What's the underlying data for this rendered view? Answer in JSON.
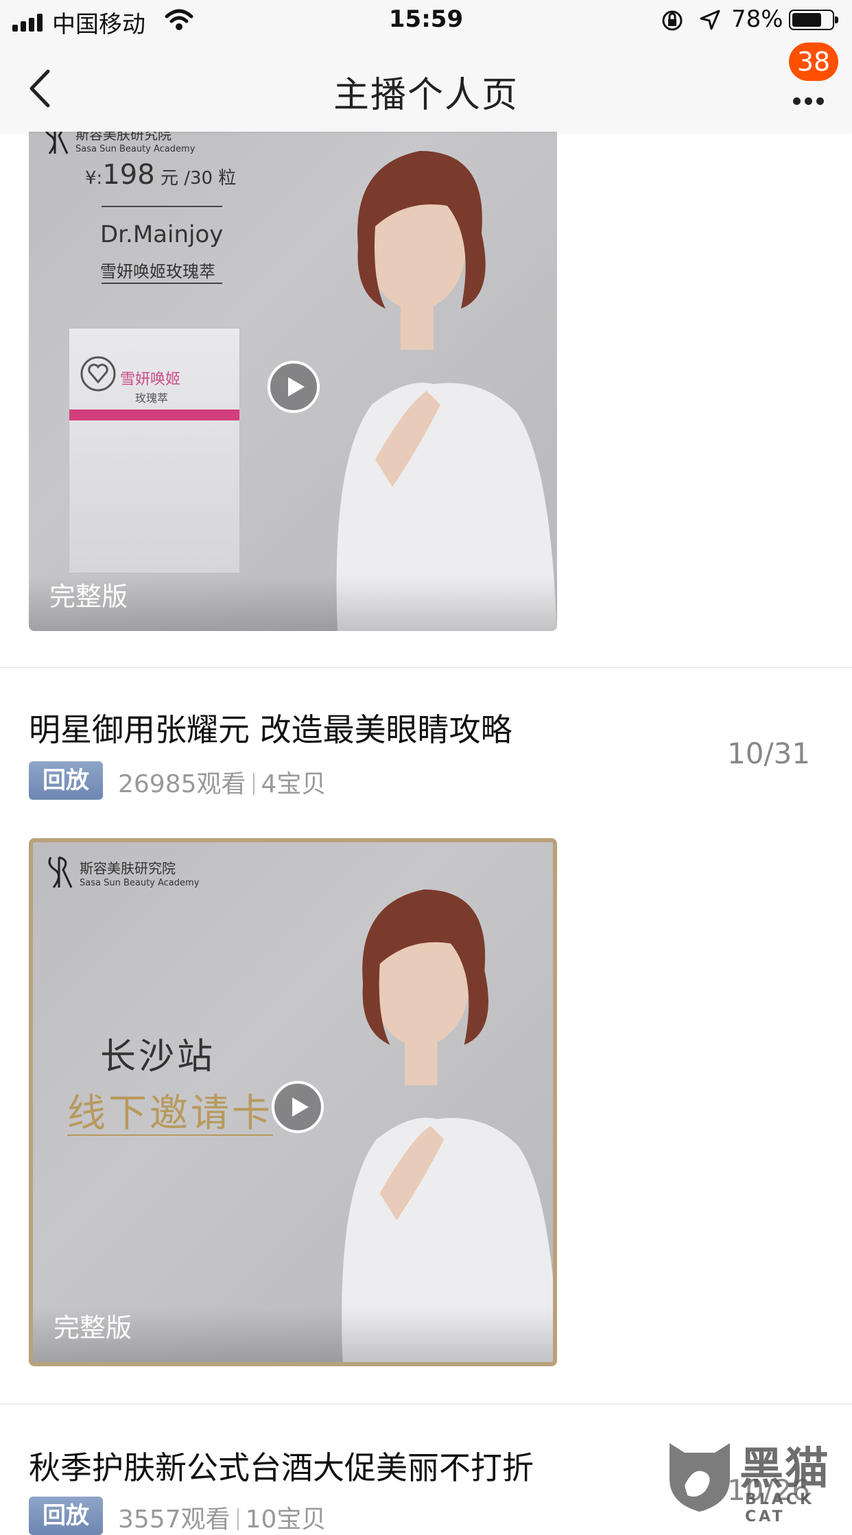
{
  "status_bar": {
    "carrier": "中国移动",
    "time": "15:59",
    "battery_percent": "78%",
    "battery_level": 0.78
  },
  "nav": {
    "title": "主播个人页",
    "badge_count": "38"
  },
  "videos": [
    {
      "org_cn": "斯容美肤研究院",
      "org_en": "Sasa Sun Beauty Academy",
      "price_prefix": "¥:",
      "price_value": "198",
      "price_suffix": "元 /30 粒",
      "product_en": "Dr.Mainjoy",
      "product_cn": "雪妍唤姬玫瑰萃",
      "box_name": "雪妍唤姬",
      "box_sub": "玫瑰萃",
      "full_version_label": "完整版"
    },
    {
      "title": "明星御用张耀元 改造最美眼睛攻略",
      "tag": "回放",
      "views": "26985观看",
      "items": "4宝贝",
      "date": "10/31",
      "org_cn": "斯容美肤研究院",
      "org_en": "Sasa Sun Beauty Academy",
      "city": "长沙站",
      "invite": "线下邀请卡",
      "full_version_label": "完整版"
    },
    {
      "title": "秋季护肤新公式台酒大促美丽不打折",
      "tag": "回放",
      "views": "3557观看",
      "items": "10宝贝",
      "date": "10/26"
    }
  ],
  "watermark": {
    "text_cn": "黑猫",
    "text_en": "BLACK CAT"
  }
}
